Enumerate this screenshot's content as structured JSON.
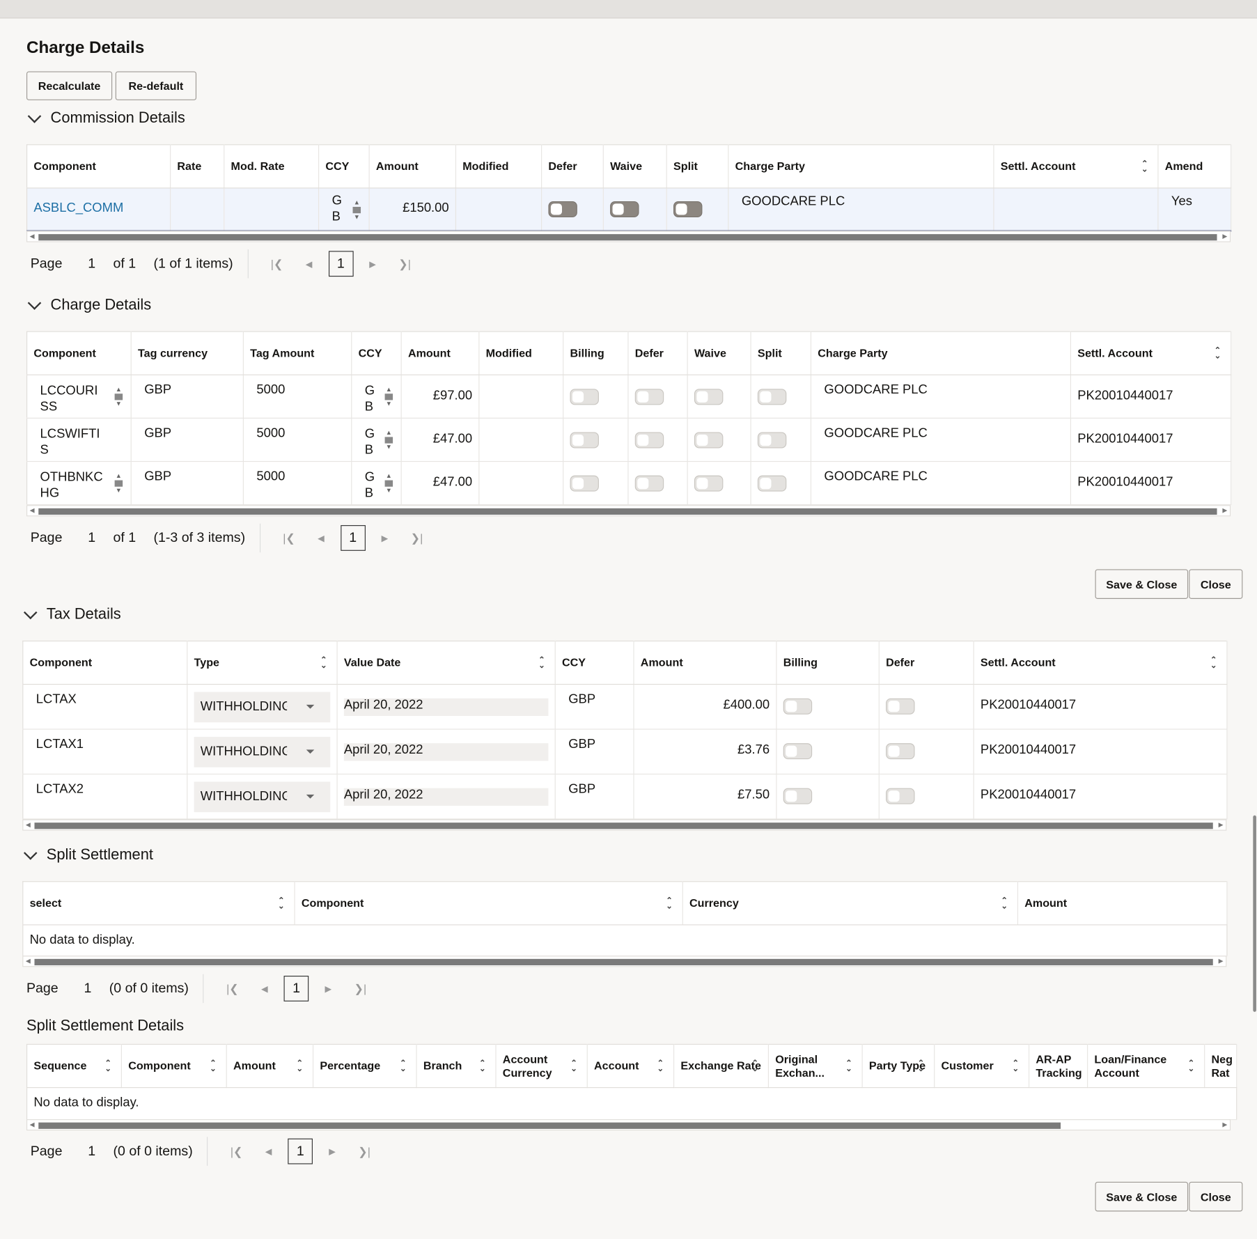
{
  "title": "Charge Details",
  "buttons": {
    "recalculate": "Recalculate",
    "redefault": "Re-default",
    "save_close": "Save & Close",
    "close": "Close"
  },
  "commission": {
    "title": "Commission Details",
    "headers": [
      "Component",
      "Rate",
      "Mod. Rate",
      "CCY",
      "Amount",
      "Modified",
      "Defer",
      "Waive",
      "Split",
      "Charge Party",
      "Settl. Account",
      "Amend"
    ],
    "rows": [
      {
        "component": "ASBLC_COMM",
        "rate": "",
        "mod_rate": "",
        "ccy": "G B",
        "amount": "£150.00",
        "modified": "",
        "defer": false,
        "waive": false,
        "split": false,
        "charge_party": "GOODCARE PLC",
        "settl_account": "",
        "amend": "Yes"
      }
    ],
    "pager": {
      "page_label": "Page",
      "page": "1",
      "of": "of 1",
      "items": "(1 of 1 items)",
      "current": "1"
    }
  },
  "charges": {
    "title": "Charge Details",
    "headers": [
      "Component",
      "Tag currency",
      "Tag Amount",
      "CCY",
      "Amount",
      "Modified",
      "Billing",
      "Defer",
      "Waive",
      "Split",
      "Charge Party",
      "Settl. Account"
    ],
    "rows": [
      {
        "component": "LCCOURISS",
        "tag_ccy": "GBP",
        "tag_amount": "5000",
        "ccy": "G B",
        "amount": "£97.00",
        "charge_party": "GOODCARE PLC",
        "settl_account": "PK20010440017"
      },
      {
        "component": "LCSWIFTIS",
        "tag_ccy": "GBP",
        "tag_amount": "5000",
        "ccy": "G B",
        "amount": "£47.00",
        "charge_party": "GOODCARE PLC",
        "settl_account": "PK20010440017"
      },
      {
        "component": "OTHBNKCHG",
        "tag_ccy": "GBP",
        "tag_amount": "5000",
        "ccy": "G B",
        "amount": "£47.00",
        "charge_party": "GOODCARE PLC",
        "settl_account": "PK20010440017"
      }
    ],
    "pager": {
      "page_label": "Page",
      "page": "1",
      "of": "of 1",
      "items": "(1-3 of 3 items)",
      "current": "1"
    }
  },
  "tax": {
    "title": "Tax Details",
    "headers": [
      "Component",
      "Type",
      "Value Date",
      "CCY",
      "Amount",
      "Billing",
      "Defer",
      "Settl. Account"
    ],
    "rows": [
      {
        "component": "LCTAX",
        "type": "WITHHOLDING",
        "value_date": "April 20, 2022",
        "ccy": "GBP",
        "amount": "£400.00",
        "settl_account": "PK20010440017"
      },
      {
        "component": "LCTAX1",
        "type": "WITHHOLDING",
        "value_date": "April 20, 2022",
        "ccy": "GBP",
        "amount": "£3.76",
        "settl_account": "PK20010440017"
      },
      {
        "component": "LCTAX2",
        "type": "WITHHOLDING",
        "value_date": "April 20, 2022",
        "ccy": "GBP",
        "amount": "£7.50",
        "settl_account": "PK20010440017"
      }
    ]
  },
  "split": {
    "title": "Split Settlement",
    "headers": [
      "select",
      "Component",
      "Currency",
      "Amount"
    ],
    "empty": "No data to display.",
    "pager": {
      "page_label": "Page",
      "page": "1",
      "items": "(0 of 0 items)",
      "current": "1"
    }
  },
  "split_details": {
    "title": "Split Settlement Details",
    "headers": [
      "Sequence",
      "Component",
      "Amount",
      "Percentage",
      "Branch",
      "Account Currency",
      "Account",
      "Exchange Rate",
      "Original Exchan...",
      "Party Type",
      "Customer",
      "AR-AP Tracking",
      "Loan/Finance Account",
      "Neg Rat"
    ],
    "empty": "No data to display.",
    "pager": {
      "page_label": "Page",
      "page": "1",
      "items": "(0 of 0 items)",
      "current": "1"
    }
  }
}
